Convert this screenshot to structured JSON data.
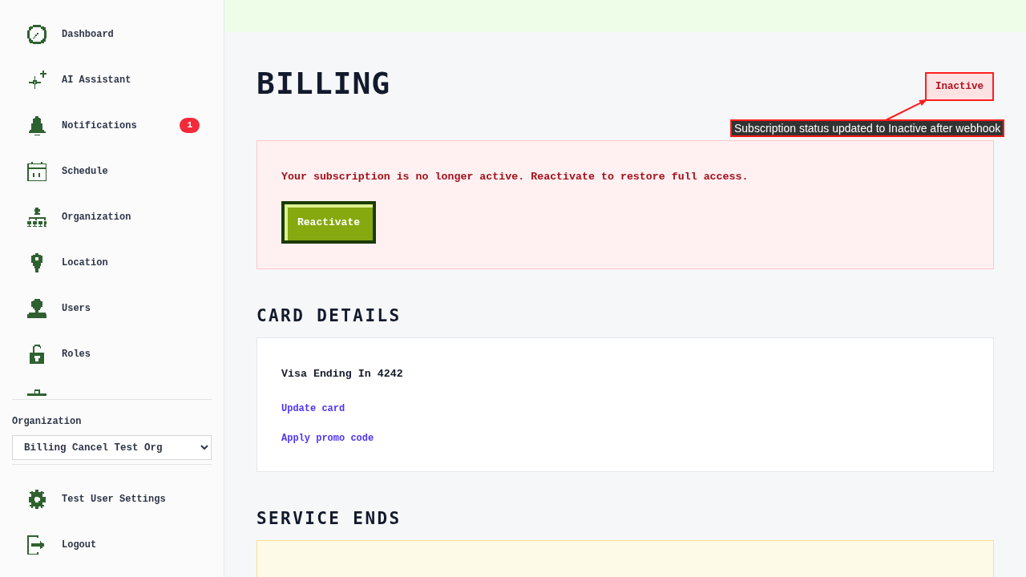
{
  "sidebar": {
    "nav_items": [
      {
        "label": "Dashboard"
      },
      {
        "label": "AI Assistant"
      },
      {
        "label": "Notifications",
        "badge": "1"
      },
      {
        "label": "Schedule"
      },
      {
        "label": "Organization"
      },
      {
        "label": "Location"
      },
      {
        "label": "Users"
      },
      {
        "label": "Roles"
      }
    ],
    "organization_select": {
      "label": "Organization",
      "value": "Billing Cancel Test Org"
    },
    "footer_items": [
      {
        "label": "Test User Settings"
      },
      {
        "label": "Logout"
      }
    ]
  },
  "page": {
    "title": "BILLING"
  },
  "alert": {
    "message": "Your subscription is no longer active. Reactivate to restore full access.",
    "button": "Reactivate"
  },
  "card_details": {
    "heading": "CARD DETAILS",
    "card": "Visa Ending In 4242",
    "links": [
      "Update card",
      "Apply promo code"
    ]
  },
  "service_ends": {
    "heading": "SERVICE ENDS"
  },
  "annotation": {
    "badge": "Inactive",
    "note": "Subscription status updated to Inactive after webhook"
  }
}
